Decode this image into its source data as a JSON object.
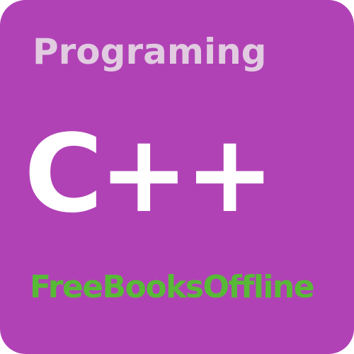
{
  "tile": {
    "subtitle": "Programing",
    "title": "C++",
    "footer": "FreeBooksOffline"
  },
  "colors": {
    "background": "#b142b6",
    "subtitle": "#e1cbe0",
    "title": "#ffffff",
    "footer": "#58b937"
  }
}
